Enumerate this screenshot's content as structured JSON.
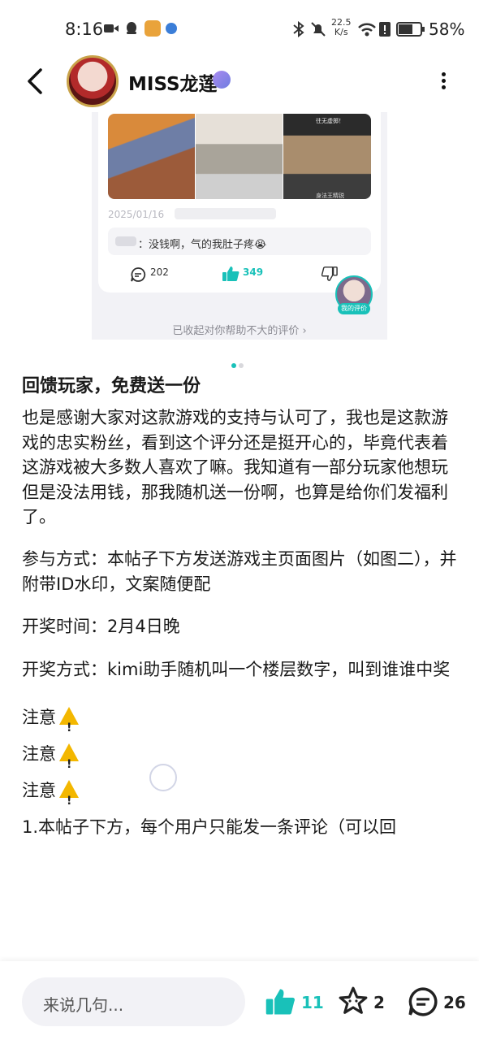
{
  "status_bar": {
    "time": "8:16",
    "network_speed": "22.5\nK/s",
    "battery": "58%"
  },
  "header": {
    "author_name": "MISS龙莲",
    "icons": [
      "back-arrow-icon",
      "avatar",
      "verified-badge-icon",
      "more-vertical-icon"
    ]
  },
  "embedded_review": {
    "thumb_top_caption": "往无虚掷！",
    "thumb_bottom_caption": "身法王精锐",
    "date": "2025/01/16",
    "comment_text": "：没钱啊，气的我肚子疼😭",
    "reply_count": "202",
    "like_count": "349",
    "my_review_tag": "我的评价",
    "collapsed_link": "已收起对你帮助不大的评价 ›"
  },
  "colors": {
    "accent": "#19c1b9"
  },
  "article": {
    "title": "回馈玩家，免费送一份",
    "paragraphs": [
      "也是感谢大家对这款游戏的支持与认可了，我也是这款游戏的忠实粉丝，看到这个评分还是挺开心的，毕竟代表着这游戏被大多数人喜欢了嘛。我知道有一部分玩家他想玩但是没法用钱，那我随机送一份啊，也算是给你们发福利了。",
      "参与方式：本帖子下方发送游戏主页面图片（如图二），并附带ID水印，文案随便配",
      "开奖时间：2月4日晚",
      "开奖方式：kimi助手随机叫一个楼层数字，叫到谁谁中奖"
    ],
    "notice": [
      "注意",
      "注意",
      "注意"
    ],
    "cut_off_line": "1.本帖子下方，每个用户只能发一条评论（可以回"
  },
  "bottom_bar": {
    "comment_placeholder": "来说几句...",
    "like_count": "11",
    "favorite_count": "2",
    "comment_count": "26"
  }
}
